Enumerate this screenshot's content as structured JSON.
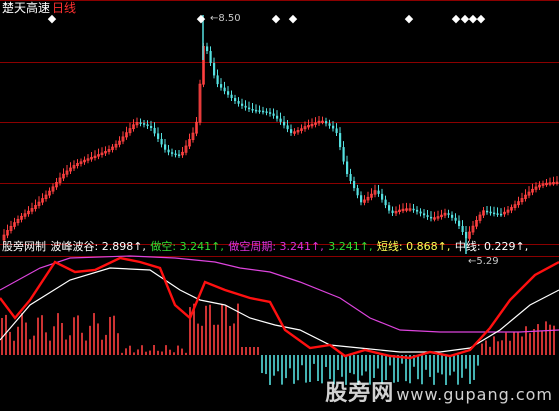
{
  "header": {
    "stock_name": "楚天高速",
    "period": "日线"
  },
  "price_panel": {
    "high_label": "8.50",
    "low_label": "5.29",
    "marker_x": [
      52,
      201,
      276,
      293,
      409,
      456,
      465,
      473,
      481
    ]
  },
  "indicator_panel": {
    "name": "股旁网制",
    "items": [
      {
        "label": "波峰波谷:",
        "value": "2.898",
        "arrow": "↑",
        "color": "#ffffff"
      },
      {
        "label": "做空:",
        "value": "3.241",
        "arrow": "↑",
        "color": "#33dd33"
      },
      {
        "label": "做空周期:",
        "value": "3.241",
        "arrow": "↑",
        "color": "#dd33dd"
      },
      {
        "label": "",
        "value": "3.241",
        "arrow": "↑",
        "color": "#33dd33"
      },
      {
        "label": "短线:",
        "value": "0.868",
        "arrow": "↑",
        "color": "#ffff55"
      },
      {
        "label": "中线:",
        "value": "0.229",
        "arrow": "↑",
        "color": "#ffffff"
      }
    ]
  },
  "watermark": {
    "text": "股旁网",
    "url": "www.gupang.com"
  },
  "colors": {
    "background": "#000000",
    "grid": "#8b0000",
    "up_candle": "#ff4040",
    "down_candle": "#55e0e0",
    "short_line": "#ffffff",
    "mid_line": "#dd44dd",
    "trend_line": "#ff1010"
  }
}
